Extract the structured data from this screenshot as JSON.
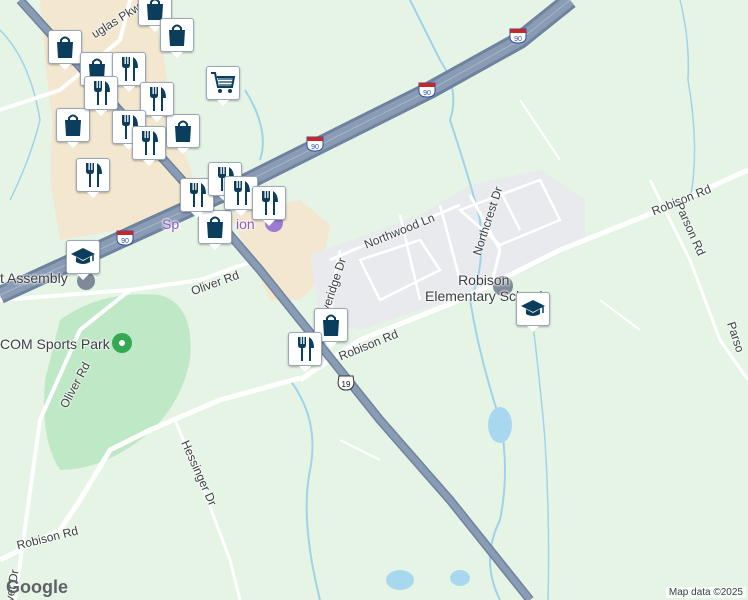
{
  "map": {
    "colors": {
      "land": "#e6f4e6",
      "park": "#bfe8c6",
      "commercial": "#f3e7cf",
      "residential": "#e8eaed",
      "highway": "#8a9bb4",
      "highway_edge": "#6f82a0",
      "road": "#ffffff",
      "water": "#a8d8f0",
      "stream": "#9fd3ea",
      "pin_icon": "#0b3d5c",
      "park_poi": "#34a853",
      "school_poi": "#7f8a99"
    },
    "road_labels": [
      {
        "id": "douglas-pkwy",
        "text": "uglas Pkwy"
      },
      {
        "id": "oliver-rd-north",
        "text": "Oliver Rd"
      },
      {
        "id": "oliver-rd-west",
        "text": "Oliver Rd"
      },
      {
        "id": "northwood-ln",
        "text": "Northwood Ln"
      },
      {
        "id": "loveridge-dr",
        "text": "loveridge Dr"
      },
      {
        "id": "northcrest-dr",
        "text": "Northcrest Dr"
      },
      {
        "id": "robison-rd-east",
        "text": "Robison Rd"
      },
      {
        "id": "robison-rd-center",
        "text": "Robison Rd"
      },
      {
        "id": "robison-rd-southwest",
        "text": "Robison Rd"
      },
      {
        "id": "parson-rd",
        "text": "Parson Rd"
      },
      {
        "id": "parson-rd-edge",
        "text": "Parso"
      },
      {
        "id": "hessinger-dr",
        "text": "Hessinger Dr"
      },
      {
        "id": "oliver-dr-edge",
        "text": "iver Dr"
      }
    ],
    "place_labels": [
      {
        "id": "sports-park",
        "text": "COM Sports Park"
      },
      {
        "id": "assembly",
        "text": "t Assembly"
      },
      {
        "id": "spa-label",
        "text": "Sp"
      },
      {
        "id": "spa-label-2",
        "text": "ion"
      },
      {
        "id": "school",
        "text": "Robison\nElementary School"
      }
    ],
    "shields": [
      {
        "id": "i90-a",
        "text": "90"
      },
      {
        "id": "i90-b",
        "text": "90"
      },
      {
        "id": "i90-c",
        "text": "90"
      },
      {
        "id": "i90-d",
        "text": "90"
      },
      {
        "id": "us19",
        "text": "19"
      }
    ],
    "pins": [
      {
        "id": "shopping-1",
        "icon": "shopping-bag"
      },
      {
        "id": "shopping-2",
        "icon": "shopping-bag"
      },
      {
        "id": "shopping-3",
        "icon": "shopping-bag"
      },
      {
        "id": "shopping-4",
        "icon": "shopping-bag"
      },
      {
        "id": "shopping-5",
        "icon": "shopping-bag"
      },
      {
        "id": "shopping-6",
        "icon": "shopping-bag"
      },
      {
        "id": "shopping-7",
        "icon": "shopping-bag"
      },
      {
        "id": "shopping-8",
        "icon": "shopping-bag"
      },
      {
        "id": "restaurant-1",
        "icon": "fork-knife"
      },
      {
        "id": "restaurant-2",
        "icon": "fork-knife"
      },
      {
        "id": "restaurant-3",
        "icon": "fork-knife"
      },
      {
        "id": "restaurant-4",
        "icon": "fork-knife"
      },
      {
        "id": "restaurant-5",
        "icon": "fork-knife"
      },
      {
        "id": "restaurant-6",
        "icon": "fork-knife"
      },
      {
        "id": "restaurant-7",
        "icon": "fork-knife"
      },
      {
        "id": "restaurant-8",
        "icon": "fork-knife"
      },
      {
        "id": "restaurant-9",
        "icon": "fork-knife"
      },
      {
        "id": "restaurant-10",
        "icon": "fork-knife"
      },
      {
        "id": "restaurant-11",
        "icon": "fork-knife"
      },
      {
        "id": "grocery-1",
        "icon": "shopping-cart"
      },
      {
        "id": "school-1",
        "icon": "graduation-cap"
      },
      {
        "id": "school-2",
        "icon": "graduation-cap"
      }
    ],
    "attribution": {
      "logo": "Google",
      "map_data": "Map data ©2025"
    }
  }
}
